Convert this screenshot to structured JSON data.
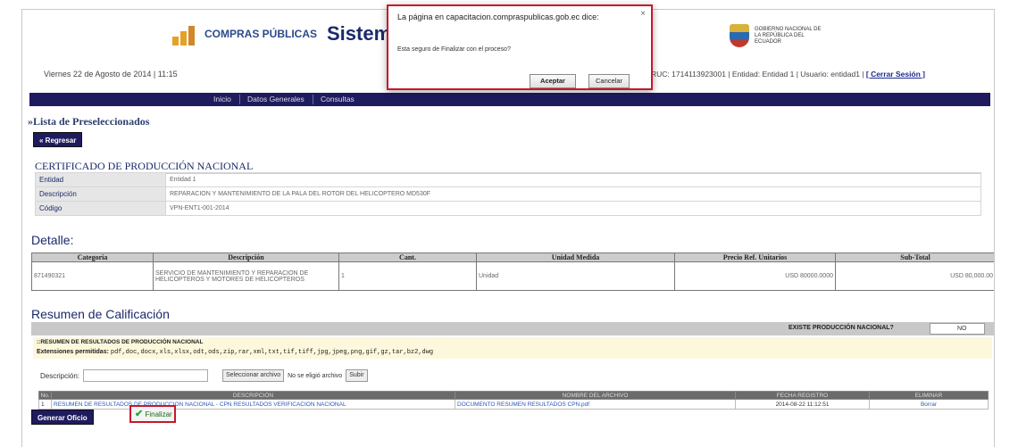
{
  "header": {
    "logo_compras": "COMPRAS PÚBLICAS",
    "site_title": "Sistem",
    "gov_logo_text": "GOBIERNO NACIONAL DE LA REPÚBLICA DEL ECUADOR",
    "date": "Viernes 22 de Agosto de 2014 | 11:15",
    "user_prefix": "RUC: 1714113923001 | Entidad: Entidad 1 | Usuario: entidad1 |",
    "logout": "[ Cerrar Sesión ]"
  },
  "nav": {
    "items": [
      "Inicio",
      "Datos Generales",
      "Consultas"
    ]
  },
  "page": {
    "section_title": "»Lista de Preseleccionados",
    "back_button": "« Regresar",
    "cert_title": "CERTIFICADO DE PRODUCCIÓN NACIONAL",
    "cert_rows": [
      {
        "label": "Entidad",
        "value": "Entidad 1"
      },
      {
        "label": "Descripción",
        "value": "REPARACION Y MANTENIMIENTO DE LA PALA DEL ROTOR DEL HELICOPTERO MD530F"
      },
      {
        "label": "Código",
        "value": "VPN-ENT1-001-2014"
      }
    ]
  },
  "detalle": {
    "title": "Detalle:",
    "headers": [
      "Categoria",
      "Descripción",
      "Cant.",
      "Unidad Medida",
      "Precio Ref. Unitarios",
      "Sub-Total"
    ],
    "row": [
      "871490321",
      "SERVICIO DE MANTENIMIENTO Y REPARACION DE HELICOPTEROS Y MOTORES DE HELICOPTEROS",
      "1",
      "Unidad",
      "USD 80000.0000",
      "USD 80,000.00"
    ]
  },
  "resumen": {
    "title": "Resumen de Calificación",
    "existe_label": "EXISTE PRODUCCIÓN NACIONAL?",
    "existe_value": "NO",
    "resumen_label": "::RESUMEN DE RESULTADOS DE PRODUCCIÓN NACIONAL",
    "ext_label": "Extensiones permitidas:",
    "ext_value": "pdf,doc,docx,xls,xlsx,odt,ods,zip,rar,xml,txt,tif,tiff,jpg,jpeg,png,gif,gz,tar,bz2,dwg",
    "desc_label": "Descripción:",
    "select_button": "Seleccionar archivo",
    "no_file": "No se eligió archivo",
    "upload_button": "Subir",
    "file_headers": [
      "No.",
      "DESCRIPCIÓN",
      "NOMBRE DEL ARCHIVO",
      "FECHA REGISTRO",
      "ELIMINAR"
    ],
    "file_row": [
      "1",
      "RESUMEN DE RESULTADOS DE PRODUCCION NACIONAL - CPN RESULTADOS VERIFICACION NACIONAL",
      "DOCUMENTO RESUMEN RESULTADOS CPN.pdf",
      "2014-08-22 11:12:51",
      "Borrar"
    ]
  },
  "actions": {
    "generar": "Generar Oficio",
    "finalizar": "Finalizar"
  },
  "dialog": {
    "title": "La página en capacitacion.compraspublicas.gob.ec dice:",
    "message": "Esta seguro de Finalizar con el proceso?",
    "ok": "Aceptar",
    "cancel": "Cancelar"
  },
  "colors": {
    "navy": "#1e1b5e",
    "highlight_red": "#c8182b"
  }
}
